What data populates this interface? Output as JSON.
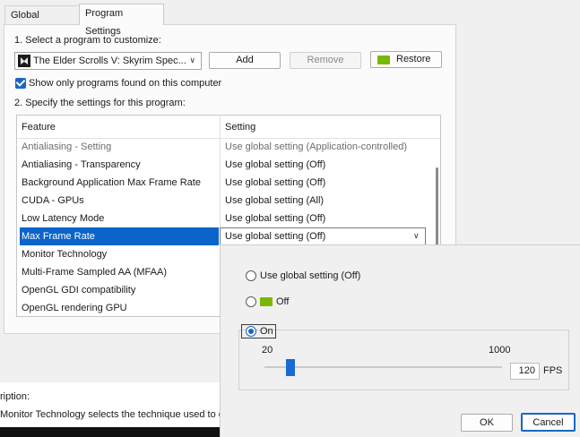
{
  "tabs": [
    "Global Settings",
    "Program Settings"
  ],
  "step1_label": "1. Select a program to customize:",
  "program_select": {
    "value": "The Elder Scrolls V: Skyrim Spec..."
  },
  "buttons": {
    "add": "Add",
    "remove": "Remove",
    "restore": "Restore"
  },
  "show_only_checkbox": {
    "label": "Show only programs found on this computer",
    "checked": true
  },
  "step2_label": "2. Specify the settings for this program:",
  "table": {
    "headers": [
      "Feature",
      "Setting"
    ],
    "rows": [
      {
        "feature": "Antialiasing - Setting",
        "setting": "Use global setting (Application-controlled)"
      },
      {
        "feature": "Antialiasing - Transparency",
        "setting": "Use global setting (Off)"
      },
      {
        "feature": "Background Application Max Frame Rate",
        "setting": "Use global setting (Off)"
      },
      {
        "feature": "CUDA - GPUs",
        "setting": "Use global setting (All)"
      },
      {
        "feature": "Low Latency Mode",
        "setting": "Use global setting (Off)"
      },
      {
        "feature": "Max Frame Rate",
        "setting": "Use global setting (Off)"
      },
      {
        "feature": "Monitor Technology",
        "setting": ""
      },
      {
        "feature": "Multi-Frame Sampled AA (MFAA)",
        "setting": ""
      },
      {
        "feature": "OpenGL GDI compatibility",
        "setting": ""
      },
      {
        "feature": "OpenGL rendering GPU",
        "setting": ""
      }
    ]
  },
  "description": {
    "label": "ription:",
    "text": "Monitor Technology selects the technique used to co"
  },
  "popup": {
    "options": {
      "global": "Use global setting (Off)",
      "off": "Off",
      "on": "On"
    },
    "selected": "on",
    "slider": {
      "min_label": "20",
      "max_label": "1000",
      "value": "120",
      "unit": "FPS",
      "min": 20,
      "max": 1000
    },
    "ok": "OK",
    "cancel": "Cancel"
  },
  "colors": {
    "accent": "#0a64c9",
    "nvidia_green": "#76b900"
  }
}
